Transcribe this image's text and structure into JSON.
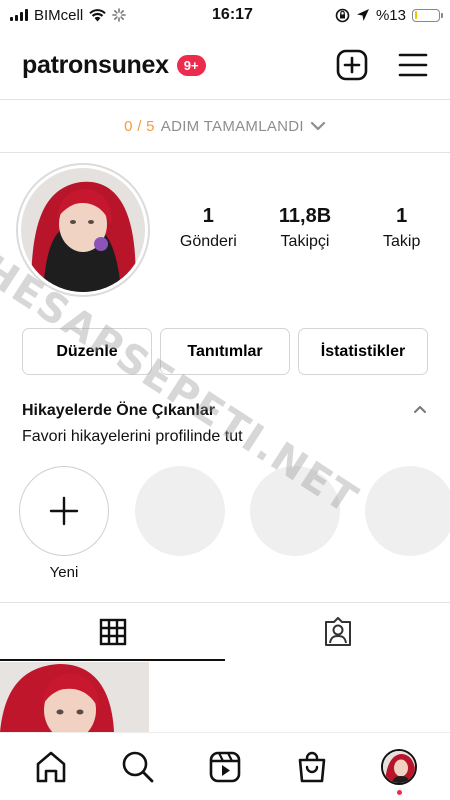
{
  "status_bar": {
    "carrier": "BIMcell",
    "time": "16:17",
    "battery_label": "%13",
    "battery_level": 0.13,
    "battery_color": "#f3c300"
  },
  "header": {
    "username": "patronsunex",
    "notification_badge": "9+",
    "badge_color": "#ed2b4d",
    "icons": [
      "plus-square-icon",
      "menu-icon"
    ]
  },
  "steps": {
    "progress": "0 / 5",
    "label": "ADIM TAMAMLANDI",
    "accent_color": "#f29d38"
  },
  "profile": {
    "stats": [
      {
        "value": "1",
        "label": "Gönderi"
      },
      {
        "value": "11,8B",
        "label": "Takipçi"
      },
      {
        "value": "1",
        "label": "Takip"
      }
    ]
  },
  "buttons": {
    "edit": "Düzenle",
    "promotions": "Tanıtımlar",
    "insights": "İstatistikler"
  },
  "highlights": {
    "title": "Hikayelerde Öne Çıkanlar",
    "subtitle": "Favori hikayelerini profilinde tut",
    "new_label": "Yeni"
  },
  "watermark": "HESAPSEPETI.NET",
  "tabs": [
    "grid-icon",
    "tagged-icon"
  ],
  "bottom_nav": [
    "home-icon",
    "search-icon",
    "reels-icon",
    "shop-icon",
    "profile-avatar"
  ]
}
